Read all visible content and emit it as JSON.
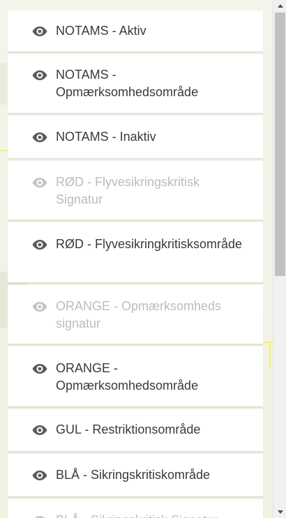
{
  "layers": [
    {
      "label": "NOTAMS - Aktiv",
      "visible": true
    },
    {
      "label": "NOTAMS - Opmærksomhedsområde",
      "visible": true
    },
    {
      "label": "NOTAMS - Inaktiv",
      "visible": true
    },
    {
      "label": "RØD - Flyvesikringskritisk Signatur",
      "visible": false
    },
    {
      "label": "RØD - Flyvesikringkritisksområde",
      "visible": true
    },
    {
      "label": "ORANGE - Opmærksomheds signatur",
      "visible": false
    },
    {
      "label": "ORANGE - Opmærksomhedsområde",
      "visible": true
    },
    {
      "label": "GUL - Restriktionsområde",
      "visible": true
    },
    {
      "label": "BLÅ - Sikringskritiskområde",
      "visible": true
    },
    {
      "label": "BLÅ - Sikringskritisk Signatur",
      "visible": false
    }
  ],
  "icons": {
    "visibility": "eye-icon",
    "scroll_up": "arrow-up-icon",
    "scroll_down": "arrow-down-icon"
  },
  "colors": {
    "text_on": "#3a3a3a",
    "text_off": "#bcbcbc",
    "eye": "#5a5a5a"
  }
}
